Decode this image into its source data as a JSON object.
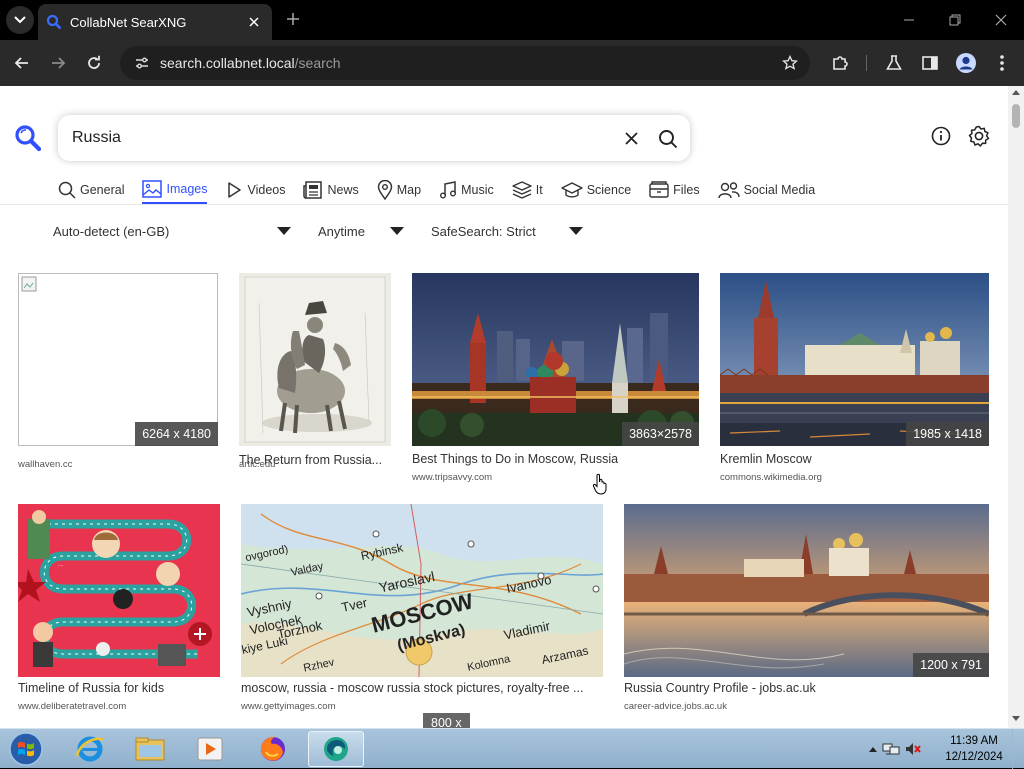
{
  "browser": {
    "tab_title": "CollabNet SearXNG",
    "url_host": "search.collabnet.local",
    "url_path": "/search"
  },
  "search": {
    "query": "Russia"
  },
  "categories": [
    {
      "label": "General",
      "icon": "search-icon"
    },
    {
      "label": "Images",
      "icon": "image-icon",
      "active": true
    },
    {
      "label": "Videos",
      "icon": "play-icon"
    },
    {
      "label": "News",
      "icon": "newspaper-icon"
    },
    {
      "label": "Map",
      "icon": "map-pin-icon"
    },
    {
      "label": "Music",
      "icon": "music-note-icon"
    },
    {
      "label": "It",
      "icon": "layers-icon"
    },
    {
      "label": "Science",
      "icon": "graduation-cap-icon"
    },
    {
      "label": "Files",
      "icon": "folder-icon"
    },
    {
      "label": "Social Media",
      "icon": "people-icon"
    }
  ],
  "filters": {
    "language": "Auto-detect (en-GB)",
    "time": "Anytime",
    "safesearch": "SafeSearch: Strict"
  },
  "results": [
    {
      "title": "",
      "source": "wallhaven.cc",
      "dimensions": "6264 x 4180"
    },
    {
      "title": "The Return from Russia...",
      "source": "artic.edu",
      "dimensions": ""
    },
    {
      "title": "Best Things to Do in Moscow, Russia",
      "source": "www.tripsavvy.com",
      "dimensions": "3863×2578"
    },
    {
      "title": "Kremlin Moscow",
      "source": "commons.wikimedia.org",
      "dimensions": "1985 x 1418"
    },
    {
      "title": "Timeline of Russia for kids",
      "source": "www.deliberatetravel.com",
      "dimensions": ""
    },
    {
      "title": "moscow, russia - moscow russia stock pictures, royalty-free ...",
      "source": "www.gettyimages.com",
      "dimensions": "800 x"
    },
    {
      "title": "Russia Country Profile - jobs.ac.uk",
      "source": "career-advice.jobs.ac.uk",
      "dimensions": "1200 x 791"
    }
  ],
  "map_labels": {
    "moscow": "MOSCOW",
    "moskva": "(Moskva)",
    "yaroslavl": "Yaroslavl",
    "tver": "Tver",
    "vladimir": "Vladimir",
    "ivanovo": "Ivanovo",
    "rybinsk": "Rybinsk",
    "vyshniy": "Vyshniy",
    "volochek": "Volochek",
    "torzhok": "Torzhok",
    "luki": "kiye Luki",
    "rzhev": "Rzhev",
    "kolomna": "Kolomna",
    "arzamas": "Arzamas",
    "valday": "Valday",
    "ovgorod": "ovgorod)"
  },
  "taskbar": {
    "time": "11:39 AM",
    "date": "12/12/2024"
  },
  "colors": {
    "accent": "#3050ff",
    "taskbar": "#a9c4dc",
    "browser_frame": "#000000",
    "toolbar": "#2a2a2a"
  }
}
